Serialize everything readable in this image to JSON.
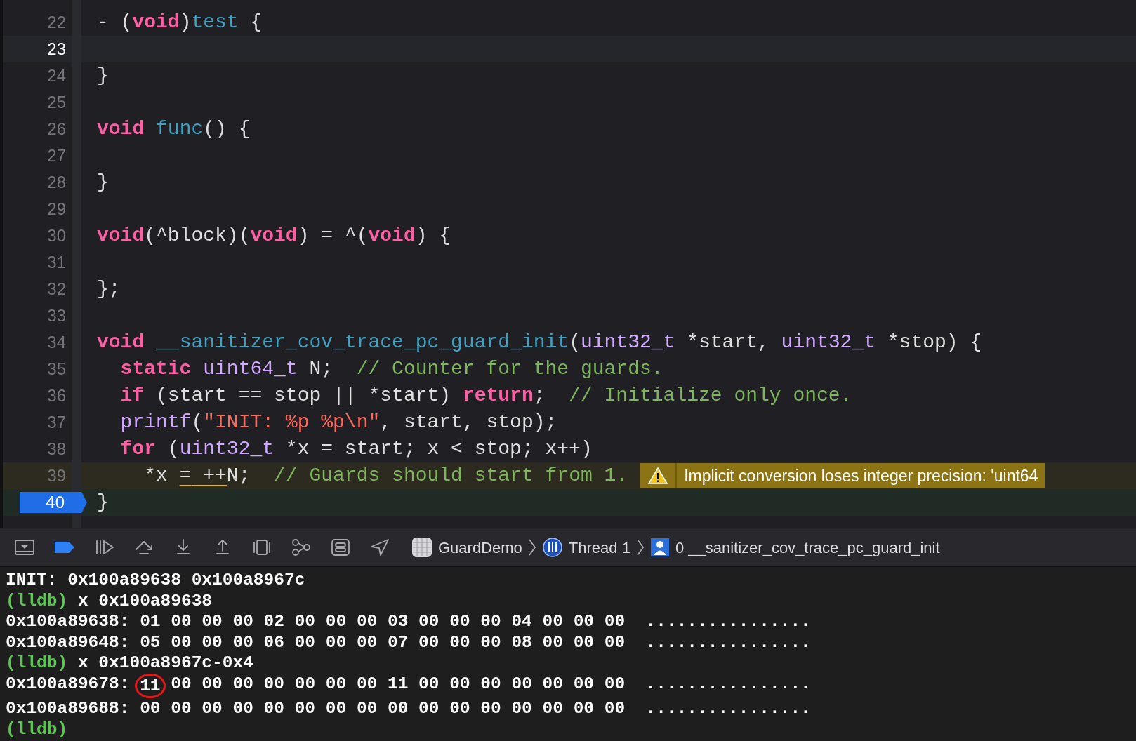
{
  "editor": {
    "lines": [
      {
        "number": "22",
        "current": false,
        "stopped": false,
        "breakpoint": false,
        "tokens": [
          {
            "kind": "plain",
            "text": "- ("
          },
          {
            "kind": "keyword",
            "text": "void"
          },
          {
            "kind": "plain",
            "text": ")"
          },
          {
            "kind": "decl",
            "text": "test"
          },
          {
            "kind": "plain",
            "text": " {"
          }
        ]
      },
      {
        "number": "23",
        "current": true,
        "stopped": false,
        "breakpoint": false
      },
      {
        "number": "24",
        "current": false,
        "stopped": false,
        "breakpoint": false,
        "tokens": [
          {
            "kind": "plain",
            "text": "}"
          }
        ]
      },
      {
        "number": "25",
        "current": false,
        "stopped": false,
        "breakpoint": false
      },
      {
        "number": "26",
        "current": false,
        "stopped": false,
        "breakpoint": false,
        "tokens": [
          {
            "kind": "keyword",
            "text": "void"
          },
          {
            "kind": "decl",
            "text": " func"
          },
          {
            "kind": "plain",
            "text": "() {"
          }
        ]
      },
      {
        "number": "27",
        "current": false,
        "stopped": false,
        "breakpoint": false
      },
      {
        "number": "28",
        "current": false,
        "stopped": false,
        "breakpoint": false,
        "tokens": [
          {
            "kind": "plain",
            "text": "}"
          }
        ]
      },
      {
        "number": "29",
        "current": false,
        "stopped": false,
        "breakpoint": false
      },
      {
        "number": "30",
        "current": false,
        "stopped": false,
        "breakpoint": false,
        "tokens": [
          {
            "kind": "keyword",
            "text": "void"
          },
          {
            "kind": "plain",
            "text": "(^block)("
          },
          {
            "kind": "keyword",
            "text": "void"
          },
          {
            "kind": "plain",
            "text": ") = ^("
          },
          {
            "kind": "keyword",
            "text": "void"
          },
          {
            "kind": "plain",
            "text": ") {"
          }
        ]
      },
      {
        "number": "31",
        "current": false,
        "stopped": false,
        "breakpoint": false
      },
      {
        "number": "32",
        "current": false,
        "stopped": false,
        "breakpoint": false,
        "tokens": [
          {
            "kind": "plain",
            "text": "};"
          }
        ]
      },
      {
        "number": "33",
        "current": false,
        "stopped": false,
        "breakpoint": false
      },
      {
        "number": "34",
        "current": false,
        "stopped": false,
        "breakpoint": false,
        "tokens": [
          {
            "kind": "keyword",
            "text": "void"
          },
          {
            "kind": "decl",
            "text": " __sanitizer_cov_trace_pc_guard_init"
          },
          {
            "kind": "plain",
            "text": "("
          },
          {
            "kind": "type",
            "text": "uint32_t"
          },
          {
            "kind": "plain",
            "text": " *start, "
          },
          {
            "kind": "type",
            "text": "uint32_t"
          },
          {
            "kind": "plain",
            "text": " *stop) {"
          }
        ]
      },
      {
        "number": "35",
        "current": false,
        "stopped": false,
        "breakpoint": false,
        "tokens": [
          {
            "kind": "keyword",
            "text": "  static"
          },
          {
            "kind": "type",
            "text": " uint64_t"
          },
          {
            "kind": "plain",
            "text": " N;  "
          },
          {
            "kind": "comment",
            "text": "// Counter for the guards."
          }
        ]
      },
      {
        "number": "36",
        "current": false,
        "stopped": false,
        "breakpoint": false,
        "tokens": [
          {
            "kind": "keyword",
            "text": "  if"
          },
          {
            "kind": "plain",
            "text": " (start == stop || *start) "
          },
          {
            "kind": "keyword",
            "text": "return"
          },
          {
            "kind": "plain",
            "text": ";  "
          },
          {
            "kind": "comment",
            "text": "// Initialize only once."
          }
        ]
      },
      {
        "number": "37",
        "current": false,
        "stopped": false,
        "breakpoint": false,
        "tokens": [
          {
            "kind": "type",
            "text": "  printf"
          },
          {
            "kind": "plain",
            "text": "("
          },
          {
            "kind": "string",
            "text": "\"INIT: %p %p\\n\""
          },
          {
            "kind": "plain",
            "text": ", start, stop);"
          }
        ]
      },
      {
        "number": "38",
        "current": false,
        "stopped": false,
        "breakpoint": false,
        "tokens": [
          {
            "kind": "keyword",
            "text": "  for"
          },
          {
            "kind": "plain",
            "text": " ("
          },
          {
            "kind": "type",
            "text": "uint32_t"
          },
          {
            "kind": "plain",
            "text": " *x = start; x < stop; x++)"
          }
        ]
      },
      {
        "number": "39",
        "current": false,
        "stopped": false,
        "breakpoint": false,
        "warning": "Implicit conversion loses integer precision: 'uint64",
        "tokens": [
          {
            "kind": "plain",
            "text": "    *x "
          },
          {
            "kind": "flagged",
            "text": "="
          },
          {
            "kind": "flagged",
            "text": " ++"
          },
          {
            "kind": "plain",
            "text": "N;  "
          },
          {
            "kind": "comment",
            "text": "// Guards should start from 1."
          }
        ]
      },
      {
        "number": "40",
        "current": false,
        "stopped": true,
        "breakpoint": true,
        "tokens": [
          {
            "kind": "plain",
            "text": "}"
          }
        ]
      }
    ]
  },
  "debug_bar": {
    "buttons": [
      {
        "kind": "console",
        "active": false
      },
      {
        "kind": "breakpoints",
        "active": true
      },
      {
        "kind": "continue",
        "active": false
      },
      {
        "kind": "step-over",
        "active": false
      },
      {
        "kind": "step-into",
        "active": false
      },
      {
        "kind": "step-out",
        "active": false
      },
      {
        "kind": "view-debugger",
        "active": false
      },
      {
        "kind": "memory-graph",
        "active": false
      },
      {
        "kind": "environment",
        "active": false
      },
      {
        "kind": "location",
        "active": false
      }
    ],
    "breadcrumb": [
      {
        "kind": "app",
        "text": "GuardDemo"
      },
      {
        "kind": "thread",
        "text": "Thread 1"
      },
      {
        "kind": "frame",
        "text": "0 __sanitizer_cov_trace_pc_guard_init"
      }
    ]
  },
  "console": {
    "lines": [
      [
        {
          "kind": "output",
          "text": "INIT: 0x100a89638 0x100a8967c"
        }
      ],
      [
        {
          "kind": "prompt",
          "text": "(lldb)"
        },
        {
          "kind": "output",
          "text": " x 0x100a89638"
        }
      ],
      [
        {
          "kind": "output",
          "text": "0x100a89638: 01 00 00 00 02 00 00 00 03 00 00 00 04 00 00 00  ................"
        }
      ],
      [
        {
          "kind": "output",
          "text": "0x100a89648: 05 00 00 00 06 00 00 00 07 00 00 00 08 00 00 00  ................"
        }
      ],
      [
        {
          "kind": "prompt",
          "text": "(lldb)"
        },
        {
          "kind": "output",
          "text": " x 0x100a8967c-0x4"
        }
      ],
      [
        {
          "kind": "output",
          "text": "0x100a89678: "
        },
        {
          "kind": "circled",
          "text": "11"
        },
        {
          "kind": "output",
          "text": " 00 00 00 00 00 00 00 11 00 00 00 00 00 00 00  ................"
        }
      ],
      [
        {
          "kind": "output",
          "text": "0x100a89688: 00 00 00 00 00 00 00 00 00 00 00 00 00 00 00 00  ................"
        }
      ],
      [
        {
          "kind": "prompt",
          "text": "(lldb)"
        }
      ]
    ]
  }
}
